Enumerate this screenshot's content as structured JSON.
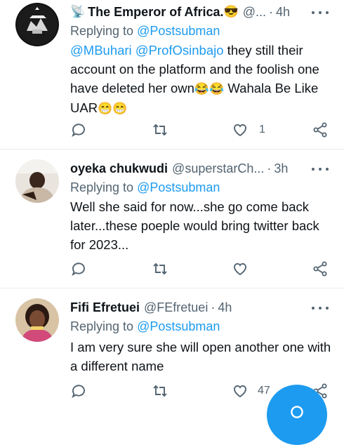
{
  "tweets": [
    {
      "name": "The Emperor of Africa.",
      "name_prefix_emoji": "📡",
      "name_suffix_emoji": "😎",
      "handle": "@...",
      "time": "4h",
      "replying_label": "Replying to",
      "replying_to": "@Postsubman",
      "mention1": "@MBuhari",
      "mention2": "@ProfOsinbajo",
      "text_part1": " they still their account on the platform and the foolish one have deleted her own",
      "emoji1": "😂😂",
      "text_part2": " Wahala Be Like UAR",
      "emoji2": "😁😁",
      "likes": "1"
    },
    {
      "name": "oyeka chukwudi",
      "handle": "@superstarCh...",
      "time": "3h",
      "replying_label": "Replying to",
      "replying_to": "@Postsubman",
      "text": "Well she said for now...she go come back later...these poeple would bring twitter back for 2023...",
      "likes": ""
    },
    {
      "name": "Fifi Efretuei",
      "handle": "@FEfretuei",
      "time": "4h",
      "replying_label": "Replying to",
      "replying_to": "@Postsubman",
      "text": "I am very sure she will open another one with a different name",
      "likes": "47"
    }
  ],
  "icons": {
    "reply": "reply-icon",
    "retweet": "retweet-icon",
    "like": "heart-icon",
    "share": "share-icon",
    "more": "more-icon",
    "compose": "compose-icon"
  },
  "colors": {
    "accent": "#1d9bf0",
    "secondary_text": "#536471",
    "divider": "#e6ecf0"
  }
}
